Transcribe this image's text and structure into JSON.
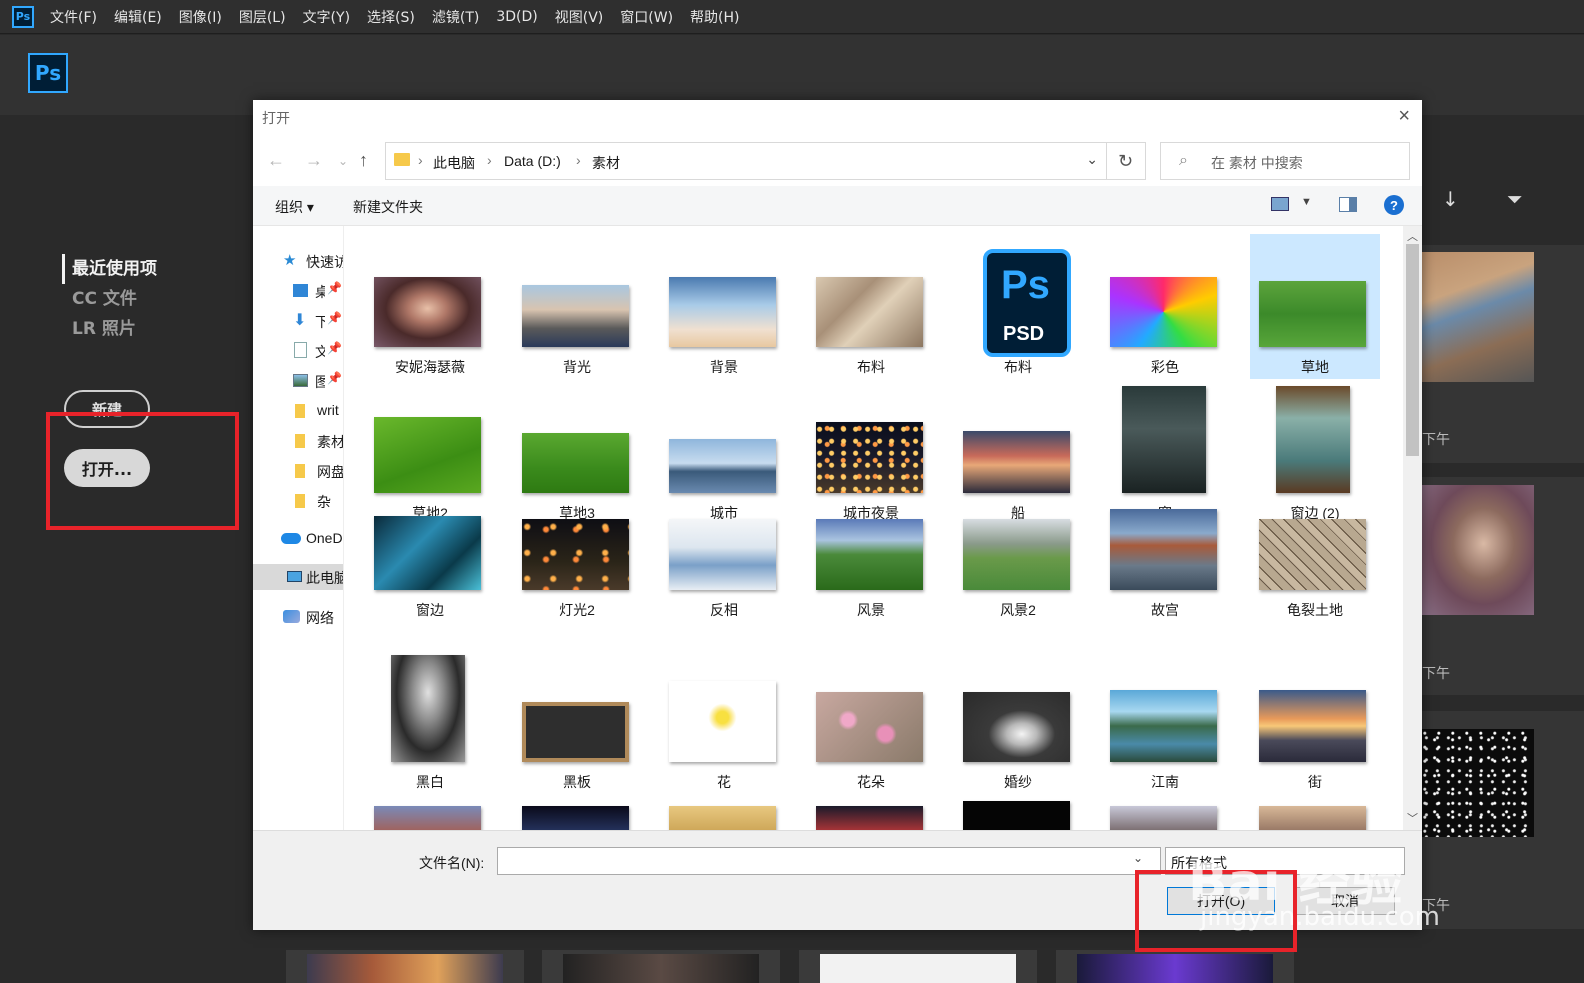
{
  "app": {
    "menu": [
      "文件(F)",
      "编辑(E)",
      "图像(I)",
      "图层(L)",
      "文字(Y)",
      "选择(S)",
      "滤镜(T)",
      "3D(D)",
      "视图(V)",
      "窗口(W)",
      "帮助(H)"
    ],
    "logo_text": "Ps",
    "nav": [
      "最近使用项",
      "CC 文件",
      "LR 照片"
    ],
    "new_button": "新建",
    "open_button": "打开...",
    "right_panel_times": [
      "下午",
      "下午",
      "下午"
    ],
    "accent_color": "#31a8ff",
    "highlight_color": "#e8232a"
  },
  "dialog": {
    "title": "打开",
    "close_icon": "×",
    "breadcrumb": [
      "此电脑",
      "Data (D:)",
      "素材"
    ],
    "search_placeholder": "在 素材 中搜索",
    "toolbar": {
      "organize": "组织 ▾",
      "new_folder": "新建文件夹",
      "help": "?"
    },
    "sidebar": [
      {
        "label": "快速访问",
        "icon": "star-icon"
      },
      {
        "label": "桌面",
        "icon": "desktop-icon"
      },
      {
        "label": "下载",
        "icon": "download-icon"
      },
      {
        "label": "文档",
        "icon": "document-icon"
      },
      {
        "label": "图片",
        "icon": "pictures-icon"
      },
      {
        "label": "writ",
        "icon": "folder-icon"
      },
      {
        "label": "素材",
        "icon": "folder-icon"
      },
      {
        "label": "网盘",
        "icon": "folder-icon"
      },
      {
        "label": "杂",
        "icon": "folder-icon"
      },
      {
        "label": "OneDrive",
        "icon": "cloud-icon"
      },
      {
        "label": "此电脑",
        "icon": "computer-icon"
      },
      {
        "label": "网络",
        "icon": "network-icon"
      }
    ],
    "files": [
      "安妮海瑟薇",
      "背光",
      "背景",
      "布料",
      "布料",
      "彩色",
      "草地",
      "草地2",
      "草地3",
      "城市",
      "城市夜景",
      "船",
      "窗",
      "窗边 (2)",
      "窗边",
      "灯光2",
      "反相",
      "风景",
      "风景2",
      "故宫",
      "龟裂土地",
      "黑白",
      "黑板",
      "花",
      "花朵",
      "婚纱",
      "江南",
      "街"
    ],
    "psd_badge": {
      "ps": "Ps",
      "ext": "PSD"
    },
    "filename_label": "文件名(N):",
    "filename_value": "",
    "filetype": "所有格式",
    "open_button": "打开(O)",
    "cancel_button": "取消"
  },
  "watermark": {
    "text": "Bai 经验",
    "sub": "jingyan.baidu.com"
  }
}
